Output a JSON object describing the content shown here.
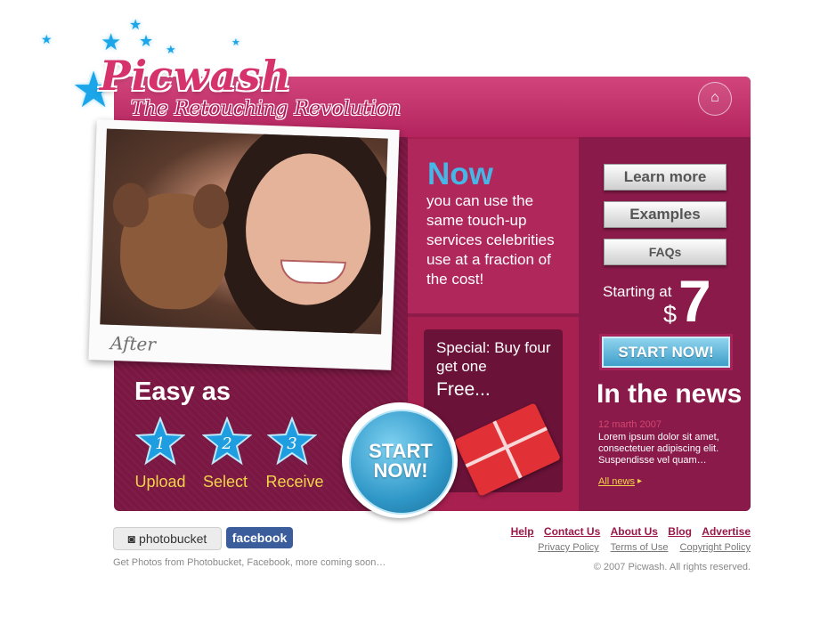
{
  "brand": {
    "name": "Picwash",
    "tagline": "The Retouching Revolution",
    "primary_color": "#b3245e",
    "accent_blue": "#46b6e6",
    "accent_yellow": "#f3d34a"
  },
  "photo": {
    "label": "After"
  },
  "steps": {
    "title": "Easy as",
    "items": [
      {
        "number": "1",
        "label": "Upload"
      },
      {
        "number": "2",
        "label": "Select"
      },
      {
        "number": "3",
        "label": "Receive"
      }
    ]
  },
  "promo": {
    "now": "Now",
    "text": "you can use the same touch-up services celebrities use at a fraction of the cost!"
  },
  "special": {
    "text": "Special: Buy four get one",
    "free": "Free..."
  },
  "big_start": {
    "label": "START NOW!"
  },
  "menu": {
    "learn_more": "Learn more",
    "examples": "Examples",
    "faqs": "FAQs"
  },
  "pricing": {
    "starting_at": "Starting at",
    "currency": "$",
    "amount": "7",
    "start_button": "START NOW!"
  },
  "news": {
    "title": "In the news",
    "date": "12 marth 2007",
    "body": "Lorem ipsum dolor sit amet, consectetuer adipiscing elit. Suspendisse vel quam…",
    "all_link": "All news"
  },
  "footer": {
    "photobucket": "photobucket",
    "facebook": "facebook",
    "note": "Get Photos from Photobucket, Facebook, more coming soon…",
    "links": [
      "Help",
      "Contact Us",
      "About Us",
      "Blog",
      "Advertise"
    ],
    "policy_links": [
      "Privacy Policy",
      "Terms of Use",
      "Copyright Policy"
    ],
    "copyright": "© 2007 Picwash. All rights reserved."
  },
  "icons": {
    "home": "home-icon",
    "stars": "star-icon",
    "arrow": "arrow-right-icon"
  }
}
